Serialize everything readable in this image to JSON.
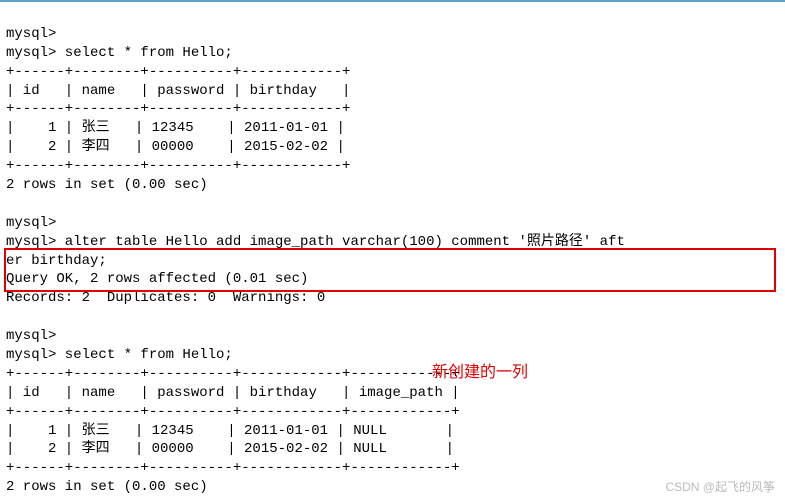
{
  "prompt": "mysql>",
  "lines": {
    "l0": "mysql>",
    "l1": "mysql> select * from Hello;",
    "sep1": "+------+--------+----------+------------+",
    "hdr1": "| id   | name   | password | birthday   |",
    "r1a": "|    1 | 张三   | 12345    | 2011-01-01 |",
    "r1b": "|    2 | 李四   | 00000    | 2015-02-02 |",
    "res1": "2 rows in set (0.00 sec)",
    "blank": "",
    "l2": "mysql>",
    "alter1": "mysql> alter table Hello add image_path varchar(100) comment '照片路径' aft",
    "alter2": "er birthday;",
    "qok": "Query OK, 2 rows affected (0.01 sec)",
    "rec": "Records: 2  Duplicates: 0  Warnings: 0",
    "l3": "mysql>",
    "l4": "mysql> select * from Hello;",
    "sep2": "+------+--------+----------+------------+------------+",
    "hdr2": "| id   | name   | password | birthday   | image_path |",
    "r2a": "|    1 | 张三   | 12345    | 2011-01-01 | NULL       |",
    "r2b": "|    2 | 李四   | 00000    | 2015-02-02 | NULL       |",
    "res2": "2 rows in set (0.00 sec)"
  },
  "annotation": "新创建的一列",
  "watermark": "CSDN @起飞的风筝",
  "chart_data": {
    "type": "table",
    "tables": [
      {
        "query": "select * from Hello;",
        "columns": [
          "id",
          "name",
          "password",
          "birthday"
        ],
        "rows": [
          {
            "id": 1,
            "name": "张三",
            "password": "12345",
            "birthday": "2011-01-01"
          },
          {
            "id": 2,
            "name": "李四",
            "password": "00000",
            "birthday": "2015-02-02"
          }
        ],
        "status": "2 rows in set (0.00 sec)"
      },
      {
        "statement": "alter table Hello add image_path varchar(100) comment '照片路径' after birthday;",
        "status": "Query OK, 2 rows affected (0.01 sec)",
        "records": 2,
        "duplicates": 0,
        "warnings": 0
      },
      {
        "query": "select * from Hello;",
        "columns": [
          "id",
          "name",
          "password",
          "birthday",
          "image_path"
        ],
        "rows": [
          {
            "id": 1,
            "name": "张三",
            "password": "12345",
            "birthday": "2011-01-01",
            "image_path": "NULL"
          },
          {
            "id": 2,
            "name": "李四",
            "password": "00000",
            "birthday": "2015-02-02",
            "image_path": "NULL"
          }
        ],
        "status": "2 rows in set (0.00 sec)"
      }
    ]
  }
}
